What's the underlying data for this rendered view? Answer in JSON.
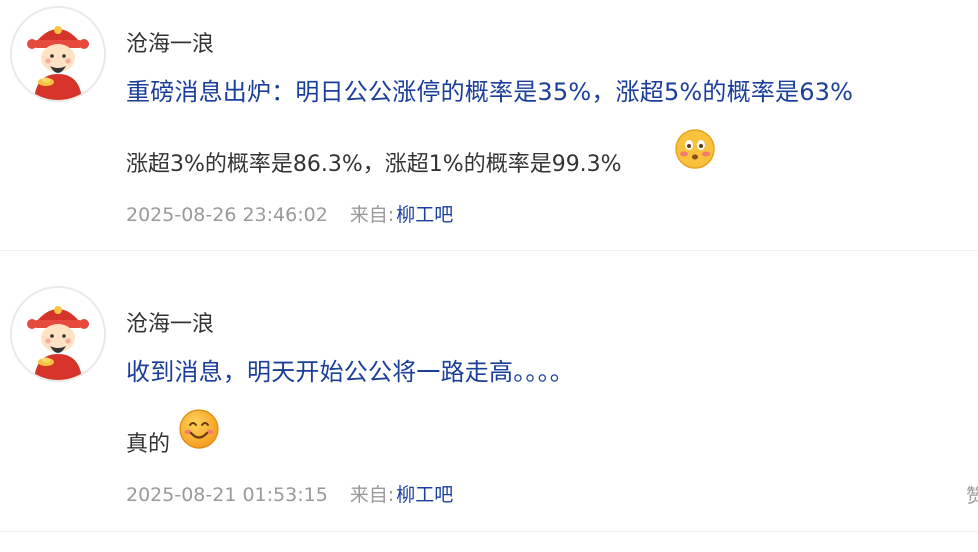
{
  "posts": [
    {
      "author": "沧海一浪",
      "title": "重磅消息出炉：明日公公涨停的概率是35%，涨超5%的概率是63%",
      "body": "涨超3%的概率是86.3%，涨超1%的概率是99.3%",
      "emoji": "blushing-face-icon",
      "time": "2025-08-26 23:46:02",
      "from_label": "来自:",
      "source": "柳工吧"
    },
    {
      "author": "沧海一浪",
      "title": "收到消息，明天开始公公将一路走高。。。。",
      "body": "真的",
      "emoji": "smiling-face-icon",
      "time": "2025-08-21 01:53:15",
      "from_label": "来自:",
      "source": "柳工吧",
      "edge_text": "赞"
    }
  ],
  "colors": {
    "title": "#1a3e9a",
    "text": "#333333",
    "meta": "#9a9a9a",
    "divider": "#eeeeee"
  }
}
